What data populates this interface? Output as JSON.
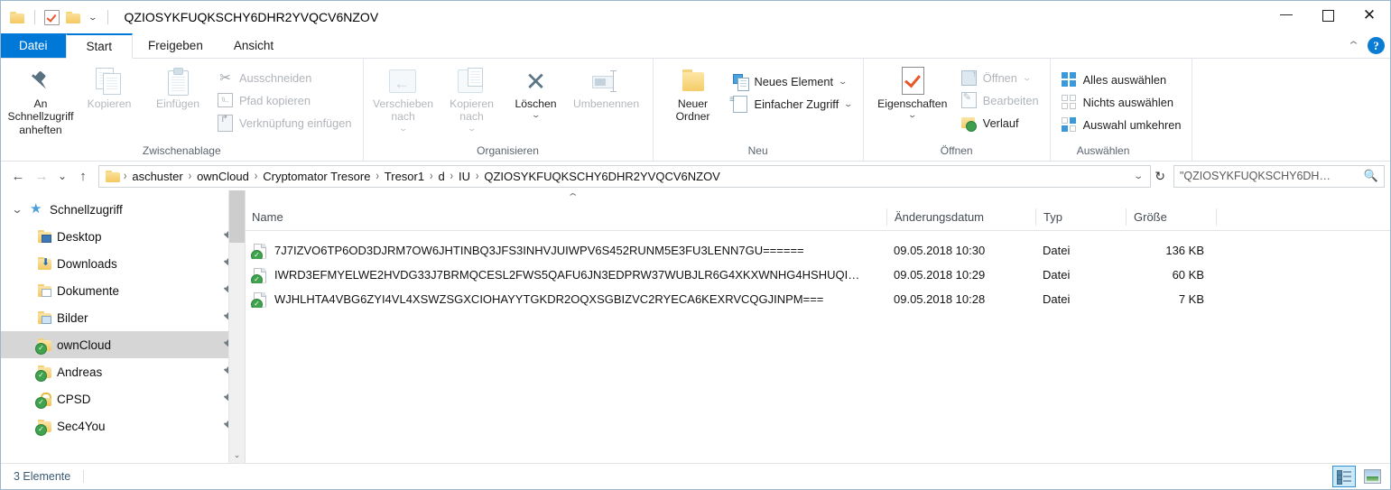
{
  "window": {
    "title": "QZIOSYKFUQKSCHY6DHR2YVQCV6NZOV",
    "quick_access_icons": [
      "folder-icon",
      "properties-check-icon",
      "new-folder-icon",
      "customize-qat-caret"
    ],
    "minimize_label": "—",
    "maximize_label": "□",
    "close_label": "✕"
  },
  "tabs": [
    {
      "label": "Datei",
      "state": "file-menu"
    },
    {
      "label": "Start",
      "state": "active"
    },
    {
      "label": "Freigeben",
      "state": "normal"
    },
    {
      "label": "Ansicht",
      "state": "normal"
    }
  ],
  "tabbar_right": {
    "collapse_label": "⌃",
    "help_label": "?"
  },
  "ribbon": {
    "groups": [
      {
        "name": "clipboard",
        "label": "Zwischenablage",
        "big_buttons": [
          {
            "label": "An Schnellzugriff\nanheften",
            "icon": "pin-icon",
            "enabled": true
          },
          {
            "label": "Kopieren",
            "icon": "copy-icon",
            "enabled": false
          },
          {
            "label": "Einfügen",
            "icon": "paste-icon",
            "enabled": false
          }
        ],
        "small_buttons": [
          {
            "label": "Ausschneiden",
            "icon": "scissors-icon",
            "enabled": false
          },
          {
            "label": "Pfad kopieren",
            "icon": "copy-path-icon",
            "enabled": false
          },
          {
            "label": "Verknüpfung einfügen",
            "icon": "paste-shortcut-icon",
            "enabled": false
          }
        ]
      },
      {
        "name": "organize",
        "label": "Organisieren",
        "big_buttons": [
          {
            "label": "Verschieben\nnach",
            "icon": "move-to-icon",
            "enabled": false,
            "caret": true
          },
          {
            "label": "Kopieren\nnach",
            "icon": "copy-to-icon",
            "enabled": false,
            "caret": true
          },
          {
            "label": "Löschen",
            "icon": "delete-x-icon",
            "enabled": true,
            "caret": true
          },
          {
            "label": "Umbenennen",
            "icon": "rename-icon",
            "enabled": false
          }
        ],
        "small_buttons": []
      },
      {
        "name": "new",
        "label": "Neu",
        "big_buttons": [
          {
            "label": "Neuer\nOrdner",
            "icon": "new-folder-icon",
            "enabled": true
          }
        ],
        "small_buttons": [
          {
            "label": "Neues Element",
            "icon": "new-item-icon",
            "enabled": true,
            "caret": true
          },
          {
            "label": "Einfacher Zugriff",
            "icon": "easy-access-icon",
            "enabled": true,
            "caret": true
          }
        ]
      },
      {
        "name": "open",
        "label": "Öffnen",
        "big_buttons": [
          {
            "label": "Eigenschaften",
            "icon": "properties-icon",
            "enabled": true,
            "caret": true
          }
        ],
        "small_buttons": [
          {
            "label": "Öffnen",
            "icon": "open-icon",
            "enabled": false,
            "caret": true
          },
          {
            "label": "Bearbeiten",
            "icon": "edit-icon",
            "enabled": false
          },
          {
            "label": "Verlauf",
            "icon": "history-icon",
            "enabled": true
          }
        ]
      },
      {
        "name": "select",
        "label": "Auswählen",
        "big_buttons": [],
        "small_buttons": [
          {
            "label": "Alles auswählen",
            "icon": "select-all-icon",
            "enabled": true
          },
          {
            "label": "Nichts auswählen",
            "icon": "select-none-icon",
            "enabled": true
          },
          {
            "label": "Auswahl umkehren",
            "icon": "invert-selection-icon",
            "enabled": true
          }
        ]
      }
    ]
  },
  "addressbar": {
    "back_label": "←",
    "forward_label": "→",
    "recent_label": "⌄",
    "up_label": "↑",
    "breadcrumbs": [
      "aschuster",
      "ownCloud",
      "Cryptomator Tresore",
      "Tresor1",
      "d",
      "IU",
      "QZIOSYKFUQKSCHY6DHR2YVQCV6NZOV"
    ],
    "separator": "›",
    "dropdown_label": "⌄",
    "refresh_label": "↻"
  },
  "search": {
    "value": "\"QZIOSYKFUQKSCHY6DH…",
    "placeholder": "\"QZIOSYKFUQKSCHY6DH…",
    "icon": "search-icon"
  },
  "navpane": {
    "items": [
      {
        "label": "Schnellzugriff",
        "icon": "star-icon",
        "level": 0,
        "twisty": "⌄",
        "pinned": false,
        "selected": false
      },
      {
        "label": "Desktop",
        "icon": "folder-desktop-icon",
        "level": 1,
        "pinned": true,
        "selected": false
      },
      {
        "label": "Downloads",
        "icon": "folder-downloads-icon",
        "level": 1,
        "pinned": true,
        "selected": false
      },
      {
        "label": "Dokumente",
        "icon": "folder-documents-icon",
        "level": 1,
        "pinned": true,
        "selected": false
      },
      {
        "label": "Bilder",
        "icon": "folder-pictures-icon",
        "level": 1,
        "pinned": true,
        "selected": false
      },
      {
        "label": "ownCloud",
        "icon": "folder-sync-icon",
        "level": 1,
        "pinned": true,
        "selected": true
      },
      {
        "label": "Andreas",
        "icon": "folder-sync-icon",
        "level": 1,
        "pinned": true,
        "selected": false
      },
      {
        "label": "CPSD",
        "icon": "lock-sync-icon",
        "level": 1,
        "pinned": true,
        "selected": false
      },
      {
        "label": "Sec4You",
        "icon": "folder-sync-icon",
        "level": 1,
        "pinned": true,
        "selected": false
      }
    ],
    "scroll_up_label": "⌃",
    "scroll_down_label": "⌄"
  },
  "filelist": {
    "sort_indicator": "⌃",
    "columns": [
      "Name",
      "Änderungsdatum",
      "Typ",
      "Größe"
    ],
    "rows": [
      {
        "name": "7J7IZVO6TP6OD3DJRM7OW6JHTINBQ3JFS3INHVJUIWPV6S452RUNM5E3FU3LENN7GU======",
        "modified": "09.05.2018 10:30",
        "type": "Datei",
        "size": "136 KB",
        "icon": "file-sync-icon"
      },
      {
        "name": "IWRD3EFMYELWE2HVDG33J7BRMQCESL2FWS5QAFU6JN3EDPRW37WUBJLR6G4XKXWNHG4HSHUQI…",
        "modified": "09.05.2018 10:29",
        "type": "Datei",
        "size": "60 KB",
        "icon": "file-sync-icon"
      },
      {
        "name": "WJHLHTA4VBG6ZYI4VL4XSWZSGXCIOHAYYTGKDR2OQXSGBIZVC2RYECA6KEXRVCQGJINPM===",
        "modified": "09.05.2018 10:28",
        "type": "Datei",
        "size": "7 KB",
        "icon": "file-sync-icon"
      }
    ]
  },
  "statusbar": {
    "item_count": "3 Elemente",
    "view_details_icon": "details-view-icon",
    "view_tiles_icon": "large-icons-view-icon"
  },
  "colors": {
    "accent": "#0078d7",
    "selection": "#d6d6d6",
    "sync_green": "#3fa34d",
    "folder_yellow": "#f3c863",
    "status_text": "#3a5a74"
  }
}
